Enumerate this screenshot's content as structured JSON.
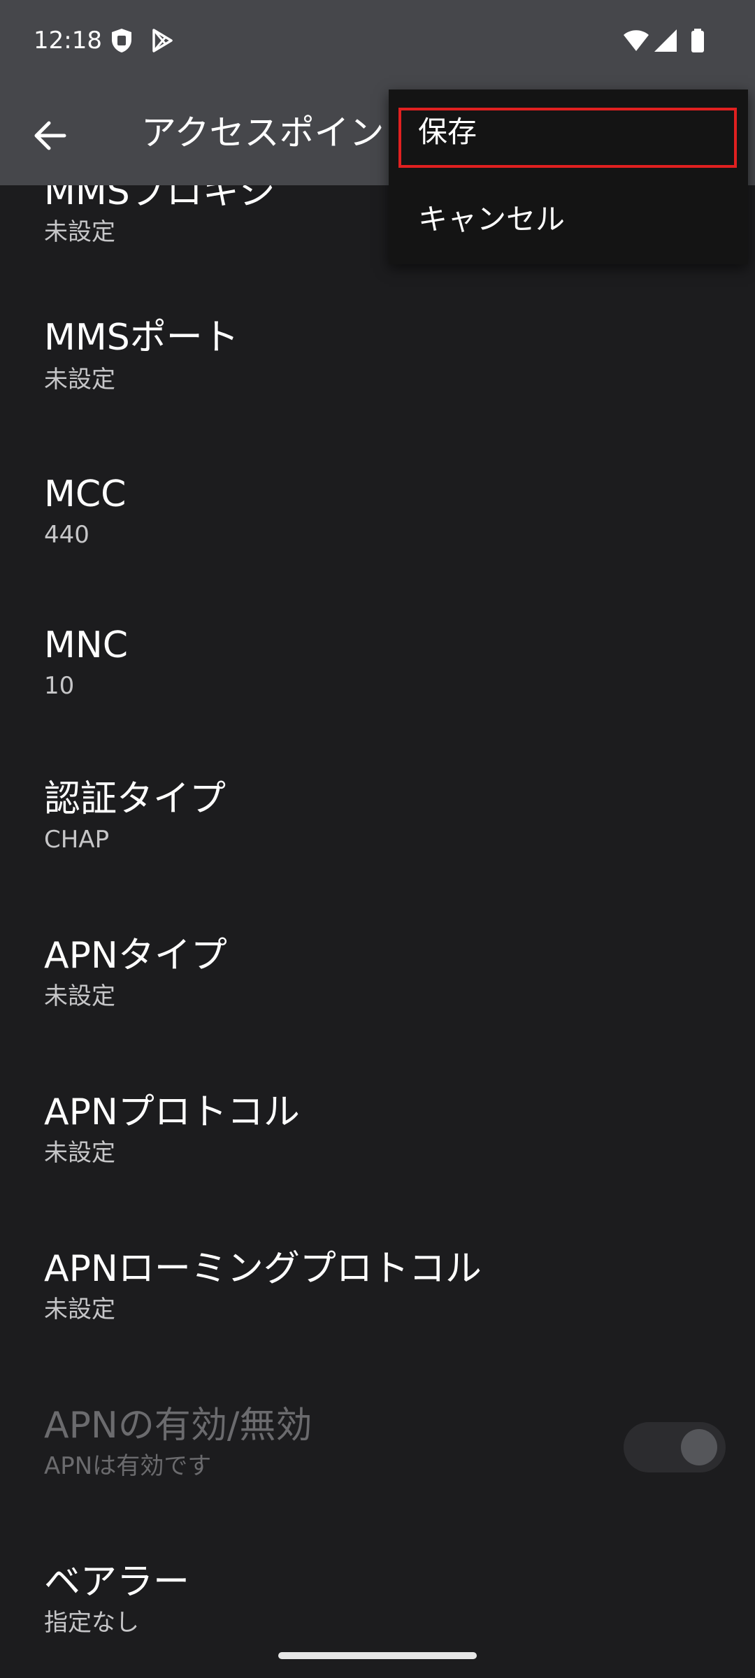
{
  "status_bar": {
    "time": "12:18",
    "icons": [
      "shield-notification-icon",
      "play-store-icon",
      "wifi-icon",
      "cell-signal-icon",
      "battery-icon"
    ]
  },
  "app_bar": {
    "back_icon": "arrow-back-icon",
    "title": "アクセスポイントの編集"
  },
  "menu": {
    "items": [
      {
        "label": "保存"
      },
      {
        "label": "キャンセル"
      }
    ]
  },
  "list": {
    "items": [
      {
        "title": "MMSプロキシ",
        "summary": "未設定"
      },
      {
        "title": "MMSポート",
        "summary": "未設定"
      },
      {
        "title": "MCC",
        "summary": "440"
      },
      {
        "title": "MNC",
        "summary": "10"
      },
      {
        "title": "認証タイプ",
        "summary": "CHAP"
      },
      {
        "title": "APNタイプ",
        "summary": "未設定"
      },
      {
        "title": "APNプロトコル",
        "summary": "未設定"
      },
      {
        "title": "APNローミングプロトコル",
        "summary": "未設定"
      },
      {
        "title": "APNの有効/無効",
        "summary": "APNは有効です",
        "toggle_on": true,
        "enabled": false
      },
      {
        "title": "ベアラー",
        "summary": "指定なし"
      }
    ]
  },
  "colors": {
    "background": "#1c1c1e",
    "app_bar": "#46474b",
    "menu": "#141414",
    "highlight": "#e02020"
  }
}
